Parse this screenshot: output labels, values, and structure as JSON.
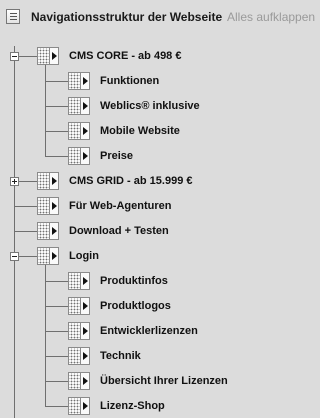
{
  "header": {
    "title": "Navigationsstruktur der Webseite",
    "expand_all_label": "Alles aufklappen",
    "icon": "list-icon"
  },
  "tree": [
    {
      "label": "CMS CORE - ab 498 €",
      "toggle": "collapse",
      "children": [
        {
          "label": "Funktionen"
        },
        {
          "label": "Weblics® inklusive"
        },
        {
          "label": "Mobile Website"
        },
        {
          "label": "Preise"
        }
      ]
    },
    {
      "label": "CMS GRID - ab 15.999 €",
      "toggle": "expand"
    },
    {
      "label": "Für Web-Agenturen"
    },
    {
      "label": "Download + Testen"
    },
    {
      "label": "Login",
      "toggle": "collapse",
      "children": [
        {
          "label": "Produktinfos"
        },
        {
          "label": "Produktlogos"
        },
        {
          "label": "Entwicklerlizenzen"
        },
        {
          "label": "Technik"
        },
        {
          "label": "Übersicht Ihrer Lizenzen"
        },
        {
          "label": "Lizenz-Shop"
        }
      ]
    }
  ]
}
